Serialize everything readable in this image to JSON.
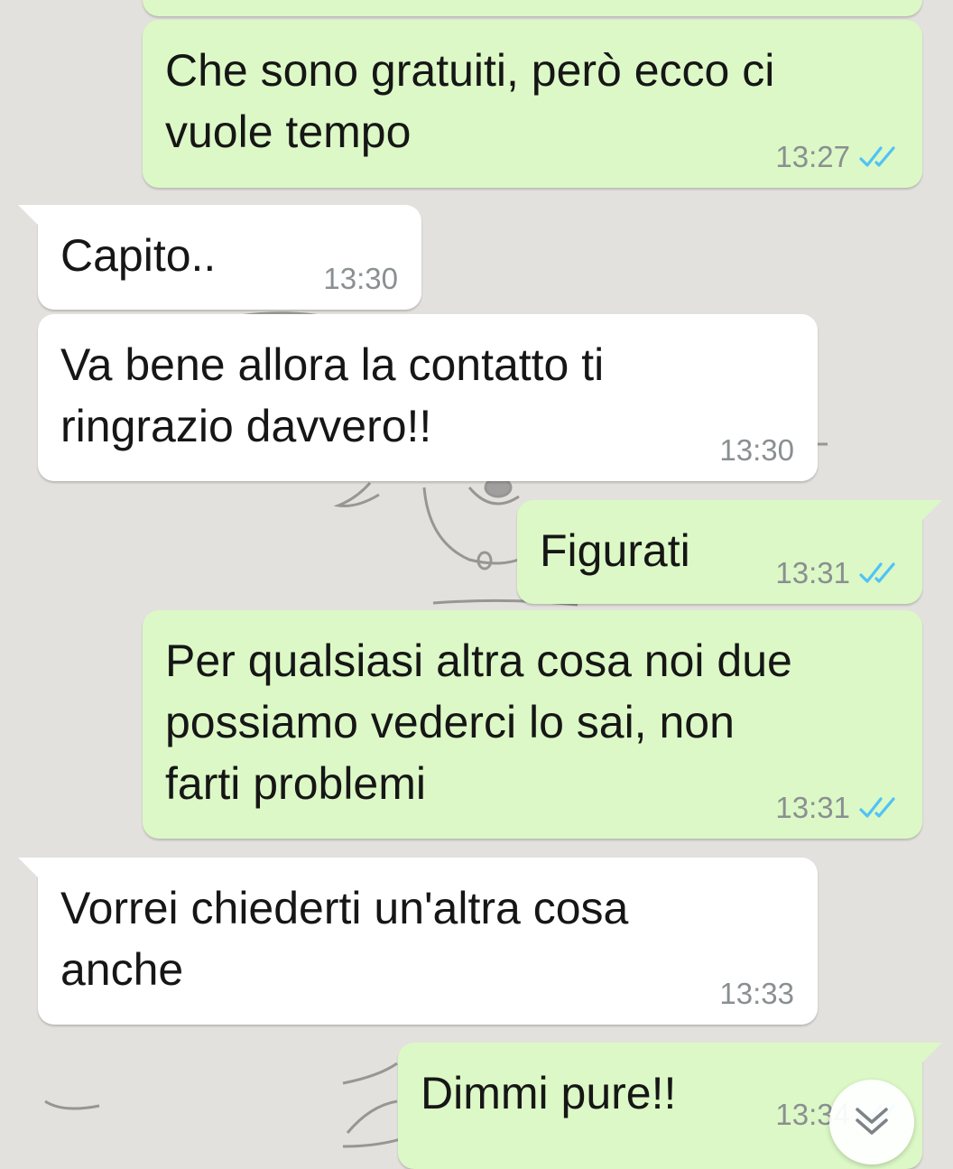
{
  "messages": [
    {
      "id": "m0",
      "direction": "outgoing",
      "text": "",
      "time": "",
      "status": ""
    },
    {
      "id": "m1",
      "direction": "outgoing",
      "text": "Che sono gratuiti, però ecco ci\nvuole tempo",
      "time": "13:27",
      "status": "read"
    },
    {
      "id": "m2",
      "direction": "incoming",
      "text": "Capito..",
      "time": "13:30"
    },
    {
      "id": "m3",
      "direction": "incoming",
      "text": "Va bene allora la contatto ti\nringrazio davvero!!",
      "time": "13:30"
    },
    {
      "id": "m4",
      "direction": "outgoing",
      "text": "Figurati",
      "time": "13:31",
      "status": "read"
    },
    {
      "id": "m5",
      "direction": "outgoing",
      "text": "Per qualsiasi altra cosa noi due\npossiamo vederci lo sai, non\nfarti problemi",
      "time": "13:31",
      "status": "read"
    },
    {
      "id": "m6",
      "direction": "incoming",
      "text": "Vorrei chiederti un'altra cosa\nanche",
      "time": "13:33"
    },
    {
      "id": "m7",
      "direction": "outgoing",
      "text": "Dimmi pure!!",
      "time": "13:34",
      "status": "read"
    }
  ],
  "colors": {
    "outgoing_bubble": "#dcf8c6",
    "incoming_bubble": "#ffffff",
    "read_tick": "#4fc3f7",
    "timestamp": "#8a8f91",
    "chat_background": "#e3e1dd"
  },
  "icons": {
    "read_receipt": "double-check-icon",
    "scroll_down": "chevron-double-down-icon"
  }
}
